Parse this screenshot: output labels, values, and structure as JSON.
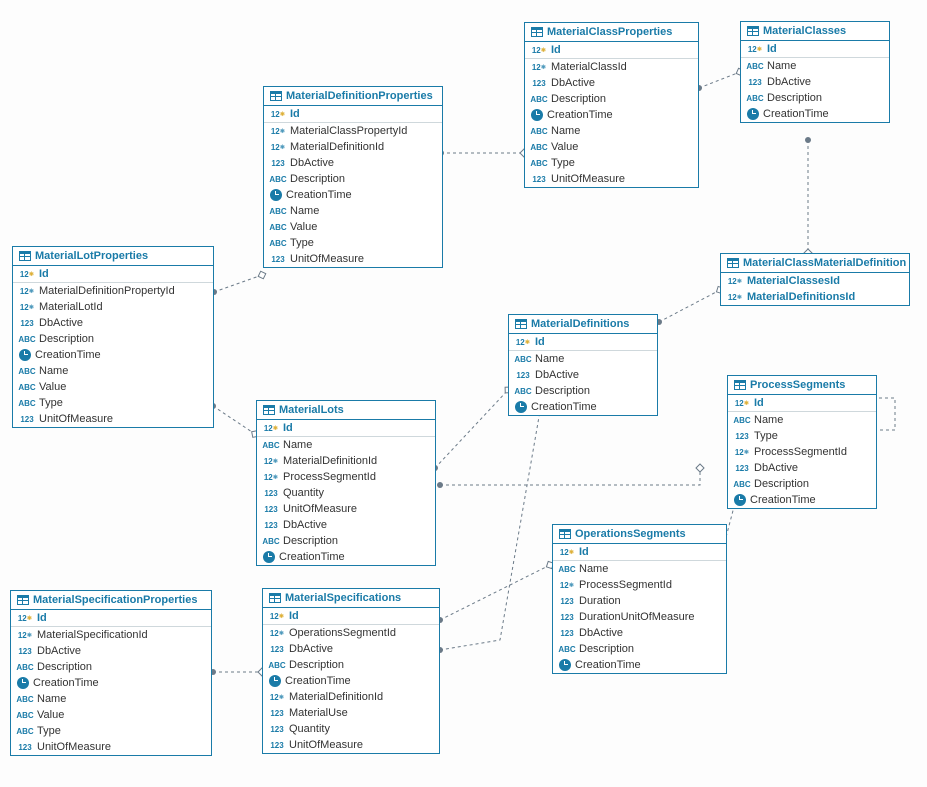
{
  "palette": {
    "line": "#1a7ba8",
    "connector": "#6b7a88"
  },
  "entities": [
    {
      "name": "MaterialLotProperties",
      "columns": [
        {
          "type": "pk",
          "label": "Id"
        },
        {
          "type": "fk",
          "label": "MaterialDefinitionPropertyId"
        },
        {
          "type": "fk",
          "label": "MaterialLotId"
        },
        {
          "type": "num",
          "label": "DbActive"
        },
        {
          "type": "txt",
          "label": "Description"
        },
        {
          "type": "time",
          "label": "CreationTime"
        },
        {
          "type": "txt",
          "label": "Name"
        },
        {
          "type": "txt",
          "label": "Value"
        },
        {
          "type": "txt",
          "label": "Type"
        },
        {
          "type": "num",
          "label": "UnitOfMeasure"
        }
      ]
    },
    {
      "name": "MaterialDefinitionProperties",
      "columns": [
        {
          "type": "pk",
          "label": "Id"
        },
        {
          "type": "fk",
          "label": "MaterialClassPropertyId"
        },
        {
          "type": "fk",
          "label": "MaterialDefinitionId"
        },
        {
          "type": "num",
          "label": "DbActive"
        },
        {
          "type": "txt",
          "label": "Description"
        },
        {
          "type": "time",
          "label": "CreationTime"
        },
        {
          "type": "txt",
          "label": "Name"
        },
        {
          "type": "txt",
          "label": "Value"
        },
        {
          "type": "txt",
          "label": "Type"
        },
        {
          "type": "num",
          "label": "UnitOfMeasure"
        }
      ]
    },
    {
      "name": "MaterialClassProperties",
      "columns": [
        {
          "type": "pk",
          "label": "Id"
        },
        {
          "type": "fk",
          "label": "MaterialClassId"
        },
        {
          "type": "num",
          "label": "DbActive"
        },
        {
          "type": "txt",
          "label": "Description"
        },
        {
          "type": "time",
          "label": "CreationTime"
        },
        {
          "type": "txt",
          "label": "Name"
        },
        {
          "type": "txt",
          "label": "Value"
        },
        {
          "type": "txt",
          "label": "Type"
        },
        {
          "type": "num",
          "label": "UnitOfMeasure"
        }
      ]
    },
    {
      "name": "MaterialClasses",
      "columns": [
        {
          "type": "pk",
          "label": "Id"
        },
        {
          "type": "txt",
          "label": "Name"
        },
        {
          "type": "num",
          "label": "DbActive"
        },
        {
          "type": "txt",
          "label": "Description"
        },
        {
          "type": "time",
          "label": "CreationTime"
        }
      ]
    },
    {
      "name": "MaterialClassMaterialDefinition",
      "columns": [
        {
          "type": "fkbold",
          "label": "MaterialClassesId"
        },
        {
          "type": "fkbold",
          "label": "MaterialDefinitionsId"
        }
      ]
    },
    {
      "name": "MaterialDefinitions",
      "columns": [
        {
          "type": "pk",
          "label": "Id"
        },
        {
          "type": "txt",
          "label": "Name"
        },
        {
          "type": "num",
          "label": "DbActive"
        },
        {
          "type": "txt",
          "label": "Description"
        },
        {
          "type": "time",
          "label": "CreationTime"
        }
      ]
    },
    {
      "name": "MaterialLots",
      "columns": [
        {
          "type": "pk",
          "label": "Id"
        },
        {
          "type": "txt",
          "label": "Name"
        },
        {
          "type": "fk",
          "label": "MaterialDefinitionId"
        },
        {
          "type": "fk",
          "label": "ProcessSegmentId"
        },
        {
          "type": "num",
          "label": "Quantity"
        },
        {
          "type": "num",
          "label": "UnitOfMeasure"
        },
        {
          "type": "num",
          "label": "DbActive"
        },
        {
          "type": "txt",
          "label": "Description"
        },
        {
          "type": "time",
          "label": "CreationTime"
        }
      ]
    },
    {
      "name": "ProcessSegments",
      "columns": [
        {
          "type": "pk",
          "label": "Id"
        },
        {
          "type": "txt",
          "label": "Name"
        },
        {
          "type": "num",
          "label": "Type"
        },
        {
          "type": "fk",
          "label": "ProcessSegmentId"
        },
        {
          "type": "num",
          "label": "DbActive"
        },
        {
          "type": "txt",
          "label": "Description"
        },
        {
          "type": "time",
          "label": "CreationTime"
        }
      ]
    },
    {
      "name": "OperationsSegments",
      "columns": [
        {
          "type": "pk",
          "label": "Id"
        },
        {
          "type": "txt",
          "label": "Name"
        },
        {
          "type": "fk",
          "label": "ProcessSegmentId"
        },
        {
          "type": "num",
          "label": "Duration"
        },
        {
          "type": "num",
          "label": "DurationUnitOfMeasure"
        },
        {
          "type": "num",
          "label": "DbActive"
        },
        {
          "type": "txt",
          "label": "Description"
        },
        {
          "type": "time",
          "label": "CreationTime"
        }
      ]
    },
    {
      "name": "MaterialSpecifications",
      "columns": [
        {
          "type": "pk",
          "label": "Id"
        },
        {
          "type": "fk",
          "label": "OperationsSegmentId"
        },
        {
          "type": "num",
          "label": "DbActive"
        },
        {
          "type": "txt",
          "label": "Description"
        },
        {
          "type": "time",
          "label": "CreationTime"
        },
        {
          "type": "fk",
          "label": "MaterialDefinitionId"
        },
        {
          "type": "num",
          "label": "MaterialUse"
        },
        {
          "type": "num",
          "label": "Quantity"
        },
        {
          "type": "num",
          "label": "UnitOfMeasure"
        }
      ]
    },
    {
      "name": "MaterialSpecificationProperties",
      "columns": [
        {
          "type": "pk",
          "label": "Id"
        },
        {
          "type": "fk",
          "label": "MaterialSpecificationId"
        },
        {
          "type": "num",
          "label": "DbActive"
        },
        {
          "type": "txt",
          "label": "Description"
        },
        {
          "type": "time",
          "label": "CreationTime"
        },
        {
          "type": "txt",
          "label": "Name"
        },
        {
          "type": "txt",
          "label": "Value"
        },
        {
          "type": "txt",
          "label": "Type"
        },
        {
          "type": "num",
          "label": "UnitOfMeasure"
        }
      ]
    }
  ],
  "relationships": [
    {
      "from": "MaterialLotProperties.MaterialDefinitionPropertyId",
      "to": "MaterialDefinitionProperties.Id"
    },
    {
      "from": "MaterialLotProperties.MaterialLotId",
      "to": "MaterialLots.Id"
    },
    {
      "from": "MaterialDefinitionProperties.MaterialClassPropertyId",
      "to": "MaterialClassProperties.Id"
    },
    {
      "from": "MaterialDefinitionProperties.MaterialDefinitionId",
      "to": "MaterialDefinitions.Id"
    },
    {
      "from": "MaterialClassProperties.MaterialClassId",
      "to": "MaterialClasses.Id"
    },
    {
      "from": "MaterialClassMaterialDefinition.MaterialClassesId",
      "to": "MaterialClasses.Id"
    },
    {
      "from": "MaterialClassMaterialDefinition.MaterialDefinitionsId",
      "to": "MaterialDefinitions.Id"
    },
    {
      "from": "MaterialLots.MaterialDefinitionId",
      "to": "MaterialDefinitions.Id"
    },
    {
      "from": "MaterialLots.ProcessSegmentId",
      "to": "ProcessSegments.Id"
    },
    {
      "from": "ProcessSegments.ProcessSegmentId",
      "to": "ProcessSegments.Id"
    },
    {
      "from": "OperationsSegments.ProcessSegmentId",
      "to": "ProcessSegments.Id"
    },
    {
      "from": "MaterialSpecifications.OperationsSegmentId",
      "to": "OperationsSegments.Id"
    },
    {
      "from": "MaterialSpecifications.MaterialDefinitionId",
      "to": "MaterialDefinitions.Id"
    },
    {
      "from": "MaterialSpecificationProperties.MaterialSpecificationId",
      "to": "MaterialSpecifications.Id"
    }
  ]
}
